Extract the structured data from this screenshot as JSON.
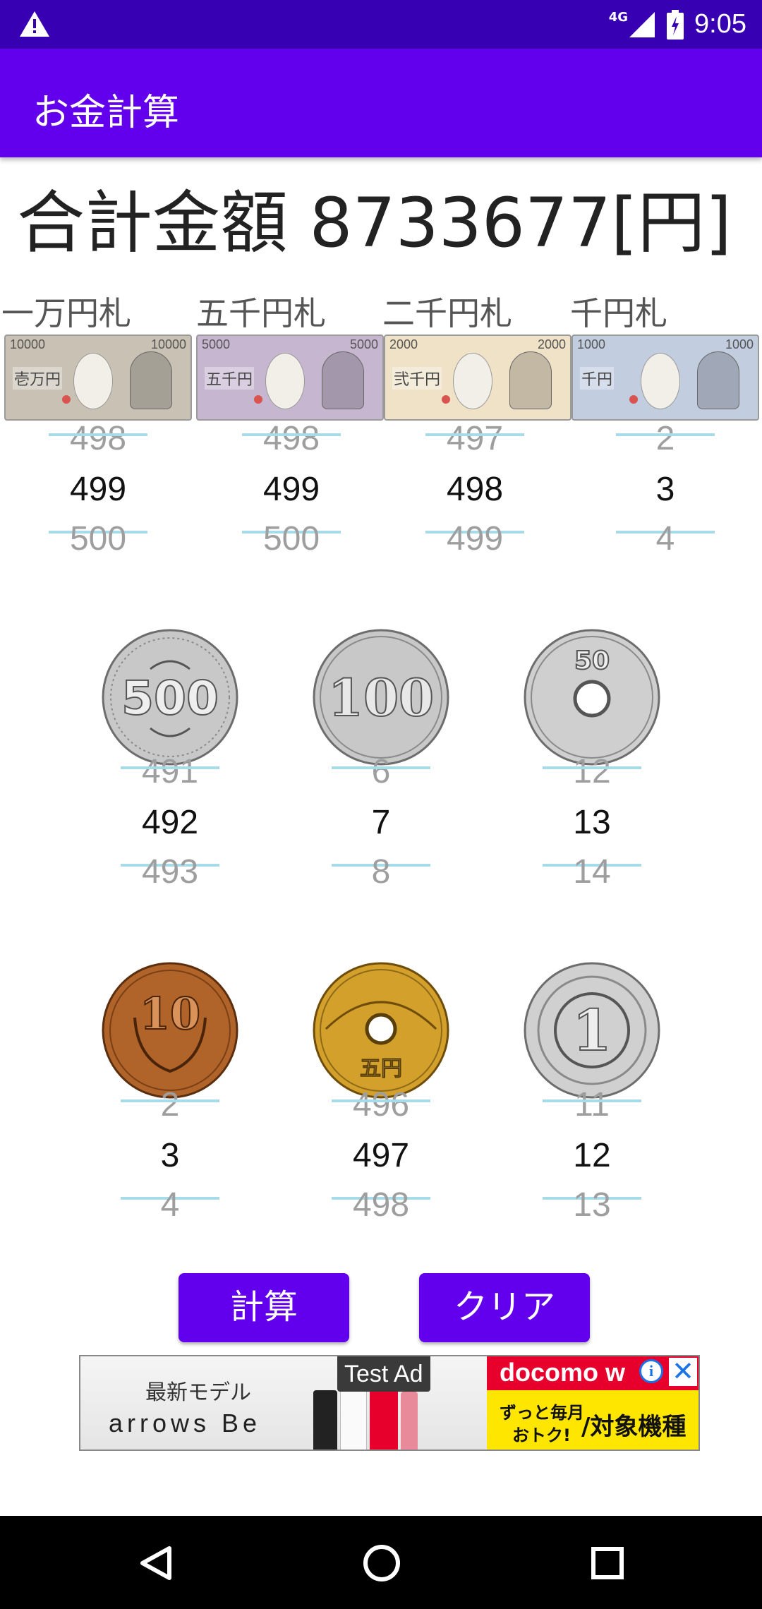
{
  "status_bar": {
    "network": "4G",
    "time": "9:05"
  },
  "app_bar": {
    "title": "お金計算"
  },
  "total": {
    "label": "合計金額 8733677[円]"
  },
  "bills": [
    {
      "label": "一万円札",
      "picker": {
        "prev": "498",
        "current": "499",
        "next": "500"
      },
      "note_text": "10000",
      "note_name": "壱万円",
      "color": "#c9c2b4"
    },
    {
      "label": "五千円札",
      "picker": {
        "prev": "498",
        "current": "499",
        "next": "500"
      },
      "note_text": "5000",
      "note_name": "五千円",
      "color": "#c6b6d0"
    },
    {
      "label": "二千円札",
      "picker": {
        "prev": "497",
        "current": "498",
        "next": "499"
      },
      "note_text": "2000",
      "note_name": "弐千円",
      "color": "#efe2c6"
    },
    {
      "label": "千円札",
      "picker": {
        "prev": "2",
        "current": "3",
        "next": "4"
      },
      "note_text": "1000",
      "note_name": "千円",
      "color": "#c2cde0"
    }
  ],
  "coins": [
    {
      "name": "500",
      "picker": {
        "prev": "491",
        "current": "492",
        "next": "493"
      },
      "color": "#c8c8c8"
    },
    {
      "name": "100",
      "picker": {
        "prev": "6",
        "current": "7",
        "next": "8"
      },
      "color": "#c8c8c8"
    },
    {
      "name": "50",
      "picker": {
        "prev": "12",
        "current": "13",
        "next": "14"
      },
      "color": "#c8c8c8"
    },
    {
      "name": "10",
      "picker": {
        "prev": "2",
        "current": "3",
        "next": "4"
      },
      "color": "#b0642a"
    },
    {
      "name": "五円",
      "picker": {
        "prev": "496",
        "current": "497",
        "next": "498"
      },
      "color": "#d4a02c"
    },
    {
      "name": "1",
      "picker": {
        "prev": "11",
        "current": "12",
        "next": "13"
      },
      "color": "#d0d0d0"
    }
  ],
  "buttons": {
    "calculate": "計算",
    "clear": "クリア"
  },
  "ad": {
    "badge": "Test Ad",
    "left_line1": "最新モデル",
    "left_line2": "arrows Be",
    "brand": "docomo w",
    "right_line1": "ずっと毎月",
    "right_line2": "おトク!",
    "right_line3": "/対象機種",
    "accent": "#e8002d",
    "yellow": "#ffe600"
  },
  "colors": {
    "primary": "#6200ee",
    "primary_dark": "#3700b3",
    "divider": "#a7dbe9"
  }
}
